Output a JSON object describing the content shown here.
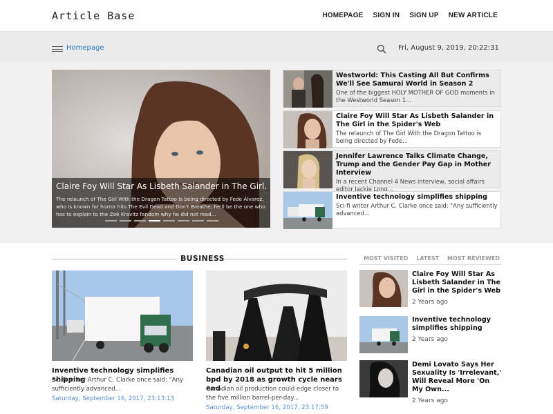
{
  "header": {
    "logo": "Article Base",
    "nav": [
      "HOMEPAGE",
      "SIGN IN",
      "SIGN UP",
      "NEW ARTICLE"
    ]
  },
  "subbar": {
    "home_link": "Homepage",
    "date": "Fri, August 9, 2019, 20:22:31",
    "icons": [
      "menu-icon",
      "search-icon"
    ]
  },
  "hero": {
    "title": "Claire Foy Will Star As Lisbeth Salander in The Girl...",
    "text": "The relaunch of The Girl With the Dragon Tattoo is being directed by Fede Álvarez, who is known for horror hits The Evil Dead and Don't Breathe; he'll be the one who has to explain to the Zoë Kravitz fandom why he did not read...",
    "slide_count": 8,
    "active_slide": 3
  },
  "side_articles": [
    {
      "title": "Westworld: This Casting All But Confirms We'll See Samurai World in Season 2",
      "desc": "One of the biggest HOLY MOTHER OF GOD moments in the Westworld Season 1..."
    },
    {
      "title": "Claire Foy Will Star As Lisbeth Salander in The Girl in the Spider's Web",
      "desc": "The relaunch of The Girl With the Dragon Tattoo is being directed by Fede..."
    },
    {
      "title": "Jennifer Lawrence Talks Climate Change, Trump and the Gender Pay Gap in Mother Interview",
      "desc": "In a recent Channel 4 News interview, social affairs editor Jackie Long..."
    },
    {
      "title": "Inventive technology simplifies shipping",
      "desc": "Sci-fi writer Arthur C. Clarke once said: \"Any sufficiently advanced..."
    }
  ],
  "business": {
    "heading": "BUSINESS",
    "cards": [
      {
        "title": "Inventive technology simplifies shipping",
        "text": "Sci-fi writer Arthur C. Clarke once said: \"Any sufficiently advanced...",
        "date": "Saturday, September 16, 2017, 23:13:13"
      },
      {
        "title": "Canadian oil output to hit 5 million bpd by 2018 as growth cycle nears end",
        "text": "Canadian oil production could edge closer to the five million barrel-per-day...",
        "date": "Saturday, September 16, 2017, 23:17:59"
      }
    ]
  },
  "sidebar": {
    "tabs": [
      "MOST VISITED",
      "LATEST",
      "MOST REVIEWED"
    ],
    "items": [
      {
        "title": "Claire Foy Will Star As Lisbeth Salander in The Girl in the Spider's Web",
        "time": "2 Years ago"
      },
      {
        "title": "Inventive technology simplifies shipping",
        "time": "2 Years ago"
      },
      {
        "title": "Demi Lovato Says Her Sexuality Is 'Irrelevant,' Will Reveal More 'On My Own...",
        "time": "2 Years ago"
      }
    ]
  }
}
